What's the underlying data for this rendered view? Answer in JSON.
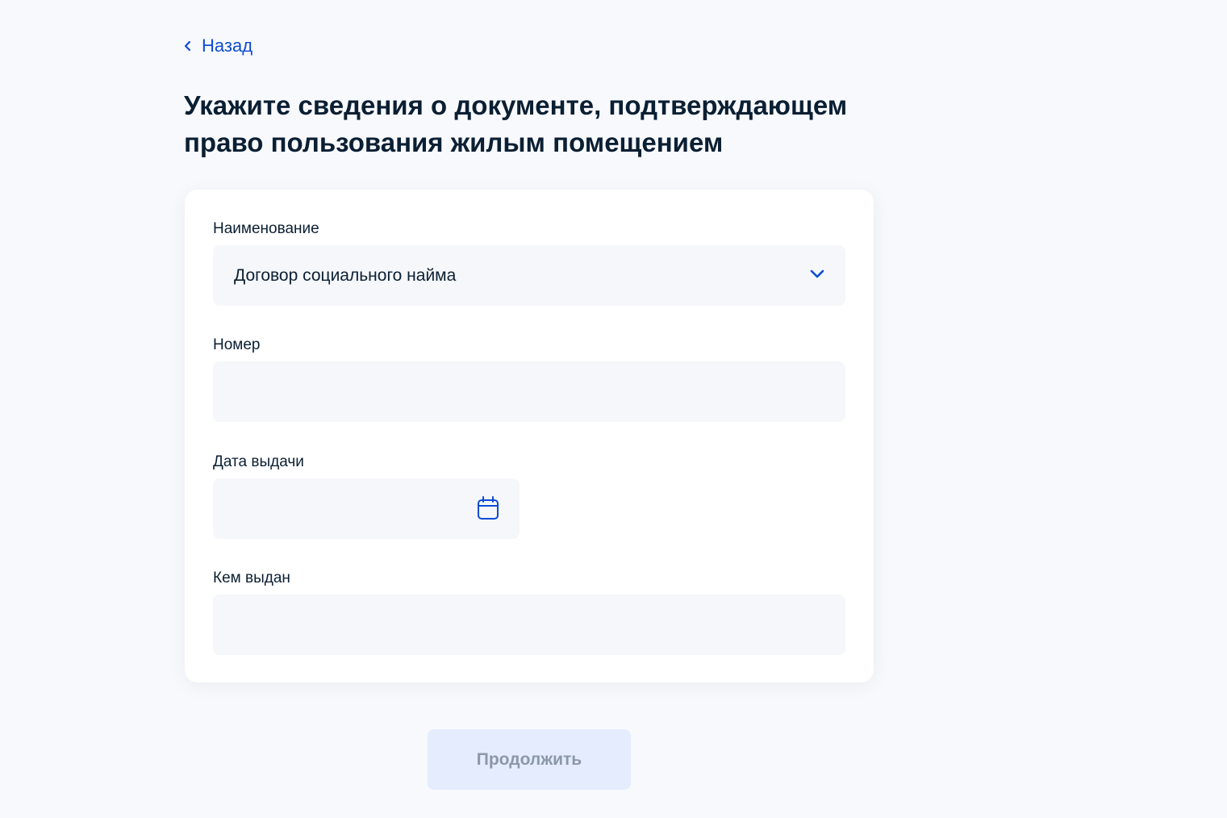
{
  "nav": {
    "back_label": "Назад"
  },
  "page": {
    "title": "Укажите сведения о документе, подтверждающем право пользования жилым помещением"
  },
  "form": {
    "name_field": {
      "label": "Наименование",
      "value": "Договор социального найма"
    },
    "number_field": {
      "label": "Номер",
      "value": ""
    },
    "issue_date_field": {
      "label": "Дата выдачи",
      "value": ""
    },
    "issued_by_field": {
      "label": "Кем выдан",
      "value": ""
    }
  },
  "actions": {
    "continue_label": "Продолжить",
    "continue_enabled": false
  },
  "icons": {
    "back": "chevron-left-icon",
    "dropdown": "chevron-down-icon",
    "calendar": "calendar-icon"
  },
  "colors": {
    "accent": "#0d4cd3",
    "text": "#0b1f33",
    "background": "#f8f9fd",
    "input_background": "#f5f7fa",
    "button_disabled_bg": "#e4ecfd",
    "button_disabled_text": "#8c97a8"
  }
}
